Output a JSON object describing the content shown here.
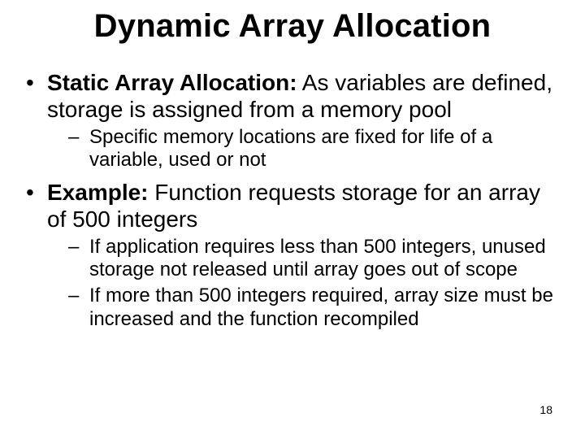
{
  "title": "Dynamic Array Allocation",
  "bullets": {
    "b1": {
      "strong": "Static Array Allocation:",
      "rest": "  As variables are defined, storage is assigned from a memory pool",
      "sub1": "Specific memory locations are fixed for life of a variable, used or not"
    },
    "b2": {
      "strong": "Example:",
      "rest": " Function requests storage for an array of 500 integers",
      "sub1": "If application requires less than 500 integers, unused storage not released until array goes out of scope",
      "sub2": "If more than 500 integers required, array size must be increased and the function recompiled"
    }
  },
  "page_number": "18"
}
